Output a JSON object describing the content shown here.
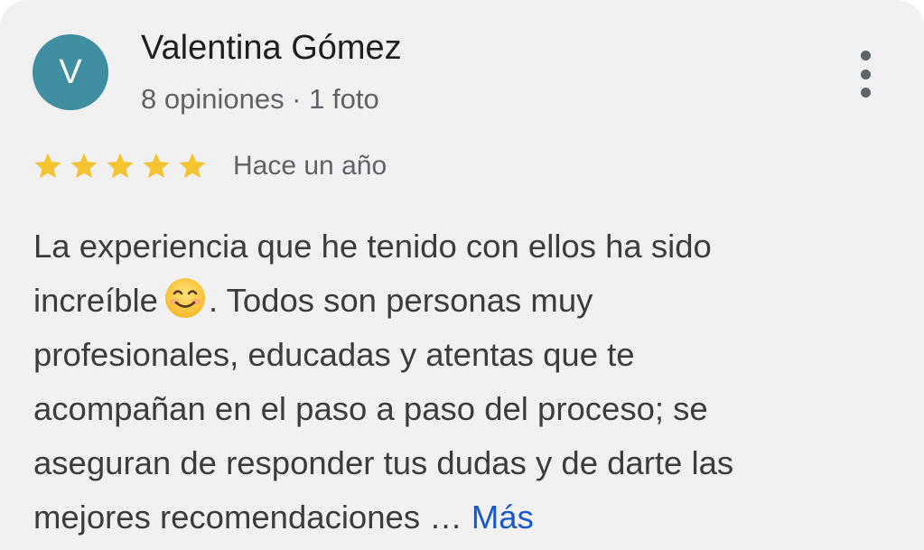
{
  "review": {
    "author": {
      "initial": "V",
      "name": "Valentina Gómez",
      "meta": "8 opiniones · 1 foto",
      "avatar_color": "#3f8fa0"
    },
    "menu_icon": "more-vertical-icon",
    "rating": 5,
    "rating_max": 5,
    "star_color": "#f4c430",
    "date": "Hace un año",
    "text_lines": [
      "La experiencia que he tenido con ellos ha sido",
      "increíble",
      ". Todos son personas muy",
      "profesionales, educadas y atentas que te",
      "acompañan en el paso a paso del proceso; se",
      "aseguran de responder tus dudas y de darte las",
      "mejores recomendaciones …"
    ],
    "emoji_icon": "smiling-face-icon",
    "more_label": "Más",
    "more_color": "#1a57c9"
  }
}
